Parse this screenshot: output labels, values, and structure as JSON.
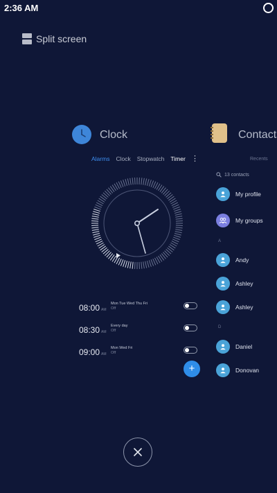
{
  "status_bar": {
    "time": "2:36 AM"
  },
  "split_screen": {
    "label": "Split screen"
  },
  "clock_app": {
    "title": "Clock",
    "tabs": [
      {
        "label": "Alarms"
      },
      {
        "label": "Clock"
      },
      {
        "label": "Stopwatch"
      },
      {
        "label": "Timer"
      }
    ],
    "more_symbol": "⋮",
    "alarms": [
      {
        "time": "08:00",
        "ampm": "AM",
        "days": "Mon Tue Wed Thu Fri",
        "status": "Off"
      },
      {
        "time": "08:30",
        "ampm": "AM",
        "days": "Every day",
        "status": "Off"
      },
      {
        "time": "09:00",
        "ampm": "AM",
        "days": "Mon Wed Fri",
        "status": "Off"
      }
    ],
    "add_symbol": "+"
  },
  "contacts_app": {
    "title": "Contacts",
    "recents_label": "Recents",
    "search_label": "13 contacts",
    "items": [
      {
        "name": "My profile"
      },
      {
        "name": "My groups"
      },
      {
        "name": "Andy"
      },
      {
        "name": "Ashley"
      },
      {
        "name": "Ashley"
      },
      {
        "name": "Daniel"
      },
      {
        "name": "Donovan"
      }
    ],
    "letters": [
      "A",
      "D"
    ]
  },
  "colors": {
    "background": "#0f1737",
    "accent": "#3d8ef0",
    "avatar": "#4aa3d8"
  }
}
